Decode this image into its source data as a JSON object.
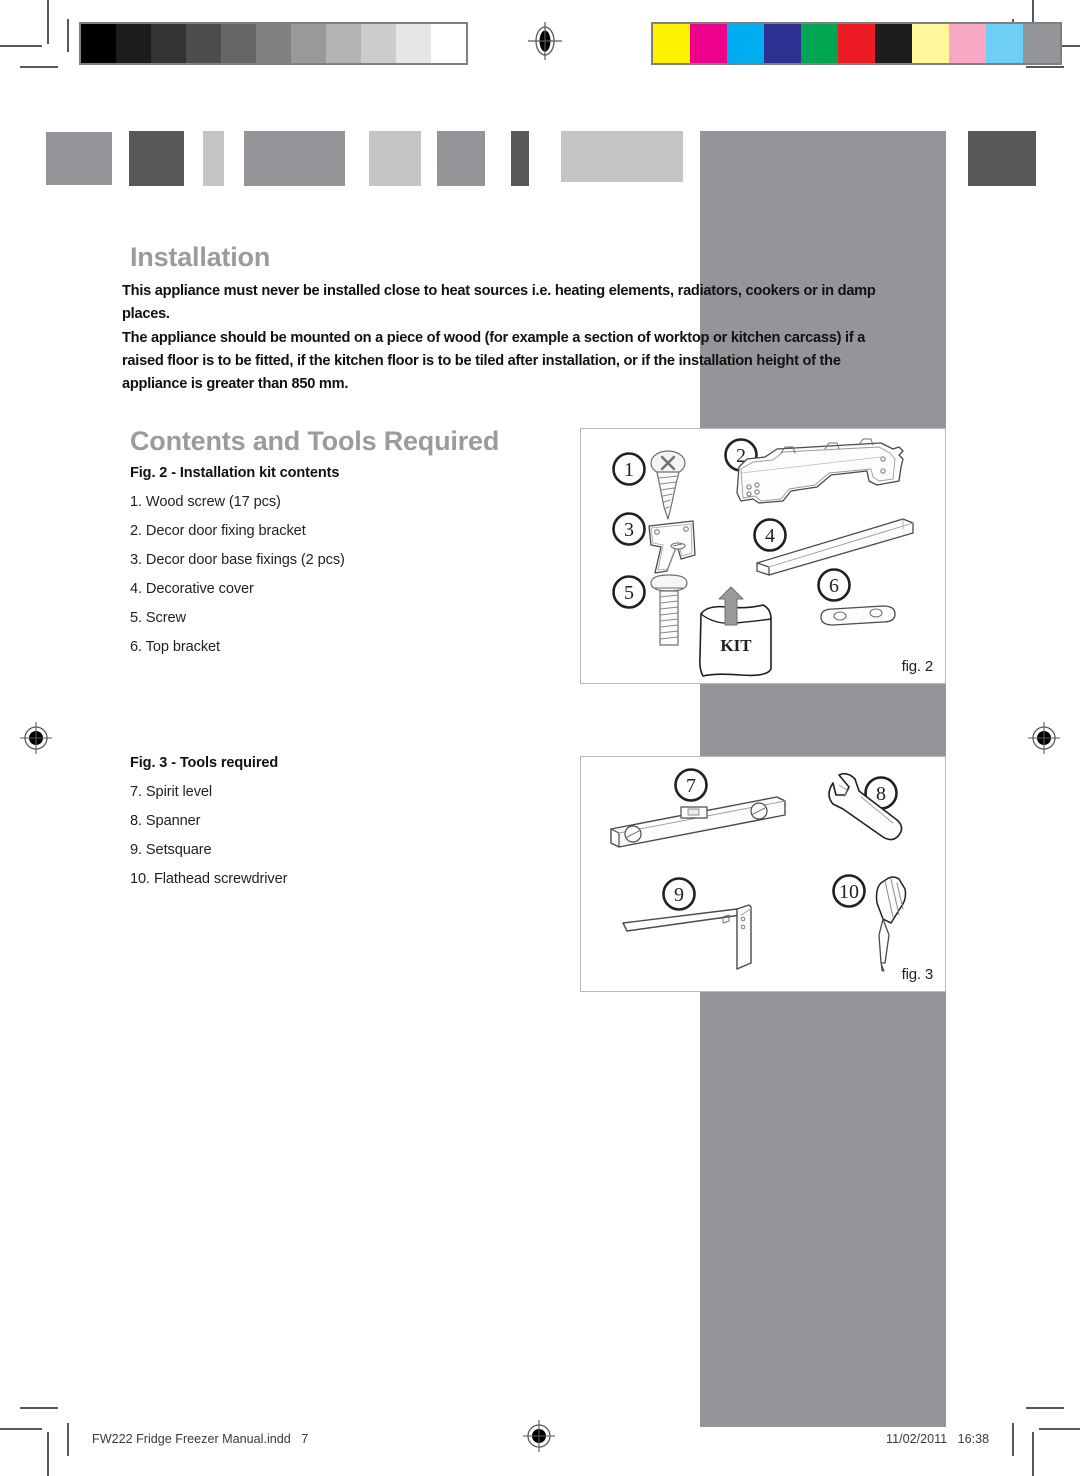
{
  "page": {
    "background": "#ffffff",
    "heading_color": "#9b9b9f",
    "band_color_mid": "#939598",
    "band_color_dark": "#58585b",
    "band_color_light": "#c4c5c7"
  },
  "prepress": {
    "grayscale_bar": {
      "name": "grayscale-color-bar",
      "swatches": [
        "#000000",
        "#1c1c1c",
        "#333333",
        "#4d4d4d",
        "#666666",
        "#808080",
        "#999999",
        "#b3b3b3",
        "#cccccc",
        "#e6e6e6",
        "#ffffff"
      ]
    },
    "cmyk_bar": {
      "name": "cmyk-color-bar",
      "swatches": [
        "#fff200",
        "#ec008c",
        "#00aeef",
        "#2e3192",
        "#00a651",
        "#ed1c24",
        "#1c1c1c",
        "#fff79a",
        "#f7a8c4",
        "#6dcff6",
        "#939598"
      ]
    },
    "registration_marks": 4
  },
  "section": {
    "title": "Installation",
    "paragraphs": [
      "This appliance must never be installed close to heat sources i.e. heating elements, radiators, cookers or in damp places.",
      "The appliance should be mounted on a piece of wood (for example a section of worktop or kitchen carcass) if a raised floor is to be fitted, if the kitchen floor is to be tiled after installation, or if the installation height of the appliance is greater than 850 mm."
    ]
  },
  "contents": {
    "title": "Contents and Tools Required",
    "fig2": {
      "caption": "Fig. 2 - Installation kit contents",
      "label": "fig. 2",
      "items": [
        "1. Wood screw (17 pcs)",
        "2. Decor door fixing bracket",
        "3. Decor door base fixings (2 pcs)",
        "4. Decorative cover",
        "5. Screw",
        "6. Top bracket"
      ],
      "callouts": [
        "1",
        "2",
        "3",
        "4",
        "5",
        "6"
      ],
      "bag_label": "KIT"
    },
    "fig3": {
      "caption": "Fig. 3 -  Tools required",
      "label": "fig. 3",
      "items": [
        "7. Spirit level",
        "8. Spanner",
        "9. Setsquare",
        "10. Flathead screwdriver"
      ],
      "callouts": [
        "7",
        "8",
        "9",
        "10"
      ]
    }
  },
  "footer": {
    "filename": "FW222 Fridge Freezer Manual.indd   7",
    "timestamp": "11/02/2011   16:38"
  }
}
